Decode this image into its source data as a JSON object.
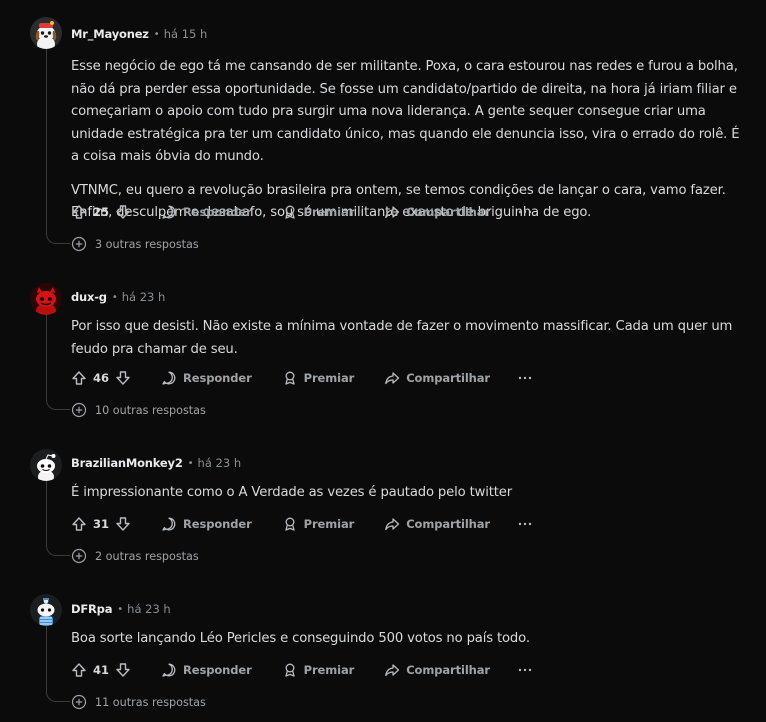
{
  "labels": {
    "reply": "Responder",
    "award": "Premiar",
    "share": "Compartilhar",
    "separator": "•"
  },
  "comments": [
    {
      "username": "Mr_Mayonez",
      "time": "há 15 h",
      "avatar": "snoo-avatar-dog",
      "paragraphs": [
        "Esse negócio de ego tá me cansando de ser militante. Poxa, o cara estourou nas redes e furou a bolha, não dá pra perder essa oportunidade. Se fosse um candidato/partido de direita, na hora já iriam filiar e começariam o apoio com tudo pra surgir uma nova liderança. A gente sequer consegue criar uma unidade estratégica pra ter um candidato único, mas quando ele denuncia isso, vira o errado do rolê. É a coisa mais óbvia do mundo.",
        "VTNMC, eu quero a revolução brasileira pra ontem, se temos condições de lançar o cara, vamo fazer. Enfim, desculpem o desabafo, sou só um militante exausto de briguinha de ego."
      ],
      "score": "25",
      "more_replies": "3 outras respostas"
    },
    {
      "username": "dux-g",
      "time": "há 23 h",
      "avatar": "snoo-avatar-red",
      "paragraphs": [
        "Por isso que desisti. Não existe a mínima vontade de fazer o movimento massificar. Cada um quer um feudo pra chamar de seu."
      ],
      "score": "46",
      "more_replies": "10 outras respostas"
    },
    {
      "username": "BrazilianMonkey2",
      "time": "há 23 h",
      "avatar": "snoo-avatar-default",
      "paragraphs": [
        "É impressionante como o A Verdade as vezes é pautado pelo twitter"
      ],
      "score": "31",
      "more_replies": "2 outras respostas"
    },
    {
      "username": "DFRpa",
      "time": "há 23 h",
      "avatar": "snoo-avatar-blue",
      "paragraphs": [
        "Boa sorte lançando Léo Pericles e conseguindo 500 votos no país todo."
      ],
      "score": "41",
      "more_replies": "11 outras respostas"
    }
  ]
}
